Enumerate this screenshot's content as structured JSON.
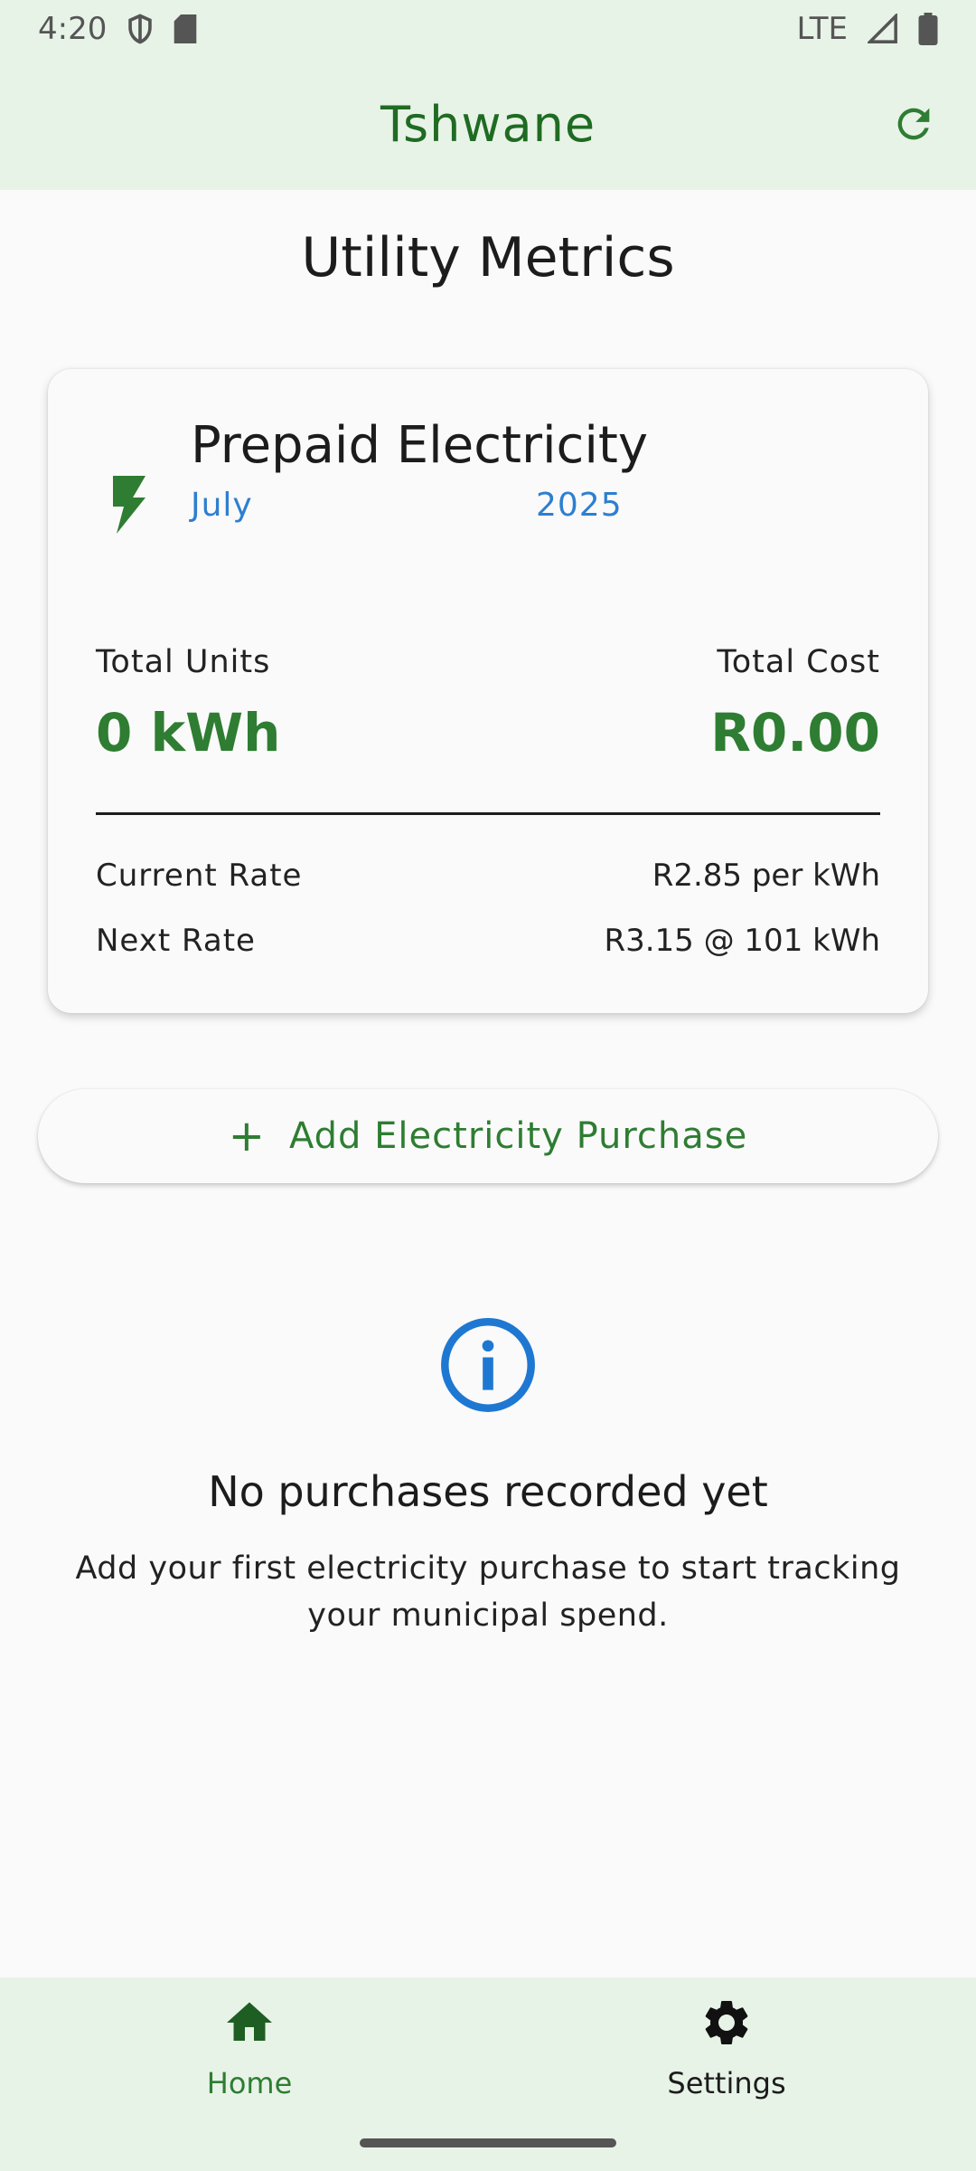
{
  "status_bar": {
    "time": "4:20",
    "network": "LTE"
  },
  "app_bar": {
    "title": "Tshwane"
  },
  "page": {
    "title": "Utility Metrics"
  },
  "card": {
    "title": "Prepaid Electricity",
    "month": "July",
    "year": "2025",
    "total_units_label": "Total Units",
    "total_units_value": "0 kWh",
    "total_cost_label": "Total Cost",
    "total_cost_value": "R0.00",
    "current_rate_label": "Current Rate",
    "current_rate_value": "R2.85 per kWh",
    "next_rate_label": "Next Rate",
    "next_rate_value": "R3.15 @ 101 kWh"
  },
  "add_button": {
    "label": "Add Electricity Purchase"
  },
  "empty_state": {
    "title": "No purchases recorded yet",
    "text": "Add your first electricity purchase to start tracking your municipal spend."
  },
  "bottom_nav": {
    "items": [
      {
        "label": "Home",
        "icon": "home-icon",
        "active": true
      },
      {
        "label": "Settings",
        "icon": "gear-icon",
        "active": false
      }
    ]
  },
  "colors": {
    "primary": "#2e7d32",
    "app_bar_bg": "#e8f3e8",
    "accent_blue": "#2d7fd0"
  }
}
